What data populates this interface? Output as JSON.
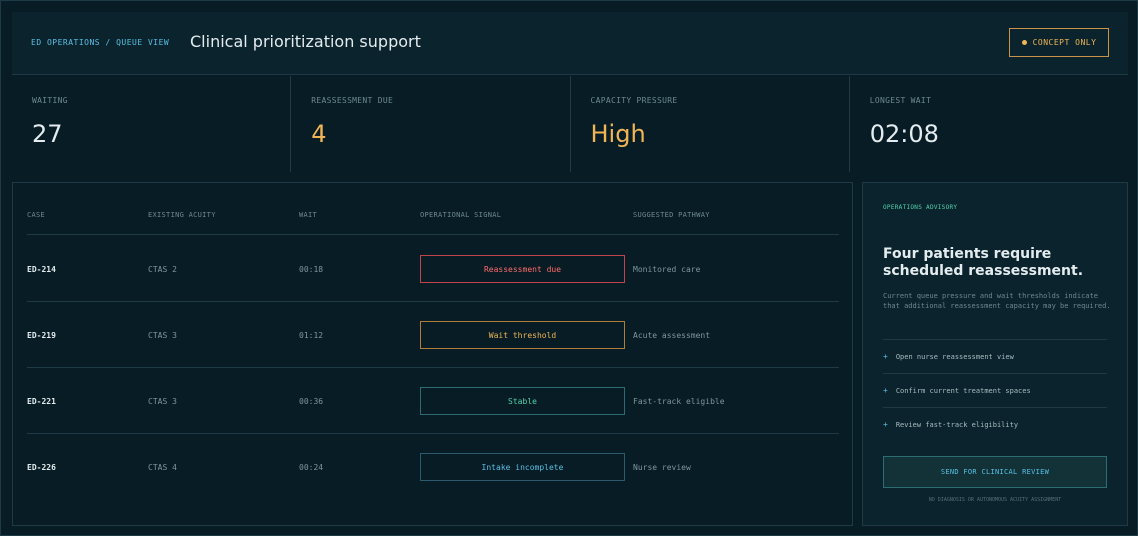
{
  "header": {
    "breadcrumb": "ED OPERATIONS / QUEUE VIEW",
    "title": "Clinical prioritization support",
    "badge": "CONCEPT ONLY"
  },
  "stats": [
    {
      "label": "WAITING",
      "value": "27"
    },
    {
      "label": "REASSESSMENT DUE",
      "value": "4"
    },
    {
      "label": "CAPACITY PRESSURE",
      "value": "High"
    },
    {
      "label": "LONGEST WAIT",
      "value": "02:08"
    }
  ],
  "table": {
    "headers": [
      "CASE",
      "EXISTING ACUITY",
      "WAIT",
      "OPERATIONAL SIGNAL",
      "SUGGESTED PATHWAY"
    ],
    "rows": [
      {
        "case": "ED-214",
        "acuity": "CTAS 2",
        "wait": "00:18",
        "signal": "Reassessment due",
        "pathway": "Monitored care"
      },
      {
        "case": "ED-219",
        "acuity": "CTAS 3",
        "wait": "01:12",
        "signal": "Wait threshold",
        "pathway": "Acute assessment"
      },
      {
        "case": "ED-221",
        "acuity": "CTAS 3",
        "wait": "00:36",
        "signal": "Stable",
        "pathway": "Fast-track eligible"
      },
      {
        "case": "ED-226",
        "acuity": "CTAS 4",
        "wait": "00:24",
        "signal": "Intake incomplete",
        "pathway": "Nurse review"
      }
    ]
  },
  "advisory": {
    "label": "OPERATIONS ADVISORY",
    "headline": "Four patients require scheduled reassessment.",
    "body": "Current queue pressure and wait thresholds indicate that additional reassessment capacity may be required.",
    "actions": [
      "Open nurse reassessment view",
      "Confirm current treatment spaces",
      "Review fast-track eligibility"
    ],
    "button": "SEND FOR CLINICAL REVIEW",
    "disclaimer": "NO DIAGNOSIS OR AUTONOMOUS ACUITY ASSIGNMENT"
  }
}
